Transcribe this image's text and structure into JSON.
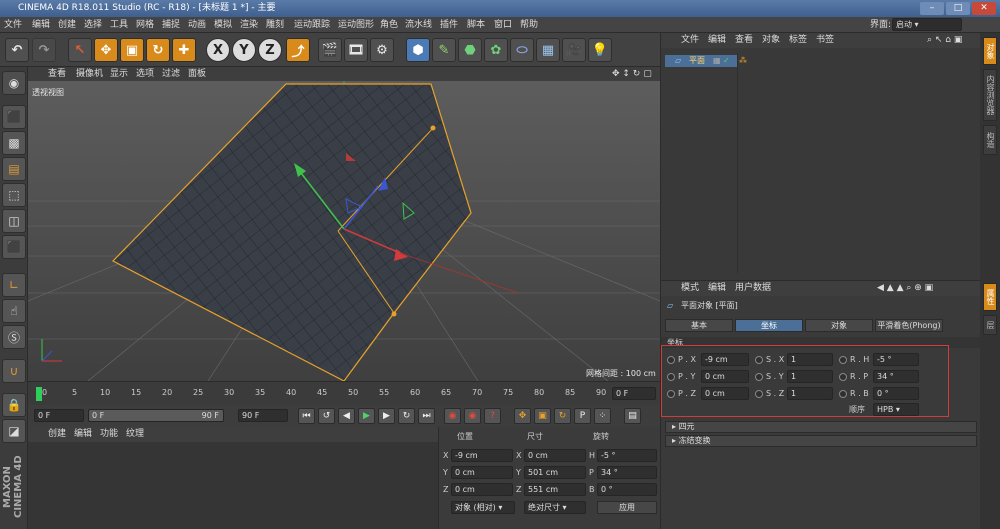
{
  "title": {
    "text": "CINEMA 4D R18.011 Studio (RC - R18) - [未标题 1 *] - 主要"
  },
  "layout_label": "界面:",
  "layout_value": "启动",
  "menu": [
    "文件",
    "编辑",
    "创建",
    "选择",
    "工具",
    "网格",
    "捕捉",
    "动画",
    "模拟",
    "渲染",
    "雕刻",
    "运动跟踪",
    "运动图形",
    "角色",
    "流水线",
    "插件",
    "脚本",
    "窗口",
    "帮助"
  ],
  "toolbar": {
    "axis_x": "X",
    "axis_y": "Y",
    "axis_z": "Z"
  },
  "viewport": {
    "menu": [
      "查看",
      "摄像机",
      "显示",
      "选项",
      "过滤",
      "面板"
    ],
    "label": "透视视图",
    "grid_info": "网格间距 : 100 cm"
  },
  "timeline": {
    "ticks": [
      "0",
      "5",
      "10",
      "15",
      "20",
      "25",
      "30",
      "35",
      "40",
      "45",
      "50",
      "55",
      "60",
      "65",
      "70",
      "75",
      "80",
      "85",
      "90"
    ],
    "end_field": "0 F"
  },
  "playbar": {
    "start": "0 F",
    "range_start": "0 F",
    "range_end": "90 F",
    "end": "90 F"
  },
  "material_manager": {
    "menu": [
      "创建",
      "编辑",
      "功能",
      "纹理"
    ]
  },
  "coord_manager": {
    "headers": {
      "position": "位置",
      "size": "尺寸",
      "rotation": "旋转"
    },
    "rows": [
      {
        "axis": "X",
        "pos": "-9 cm",
        "saxis": "X",
        "size": "0 cm",
        "raxis": "H",
        "rot": "-5 °"
      },
      {
        "axis": "Y",
        "pos": "0 cm",
        "saxis": "Y",
        "size": "501 cm",
        "raxis": "P",
        "rot": "34 °"
      },
      {
        "axis": "Z",
        "pos": "0 cm",
        "saxis": "Z",
        "size": "551 cm",
        "raxis": "B",
        "rot": "0 °"
      }
    ],
    "mode": "对象 (相对)",
    "size_mode": "绝对尺寸",
    "apply": "应用"
  },
  "object_manager": {
    "menu": [
      "文件",
      "编辑",
      "查看",
      "对象",
      "标签",
      "书签"
    ],
    "object_name": "平面"
  },
  "attribute_manager": {
    "menu": [
      "模式",
      "编辑",
      "用户数据"
    ],
    "object_title": "平面对象 [平面]",
    "tabs": [
      "基本",
      "坐标",
      "对象",
      "平滑着色(Phong)"
    ],
    "section": "坐标",
    "rows": [
      {
        "p_label": "P . X",
        "p_val": "-9 cm",
        "s_label": "S . X",
        "s_val": "1",
        "r_label": "R . H",
        "r_val": "-5 °"
      },
      {
        "p_label": "P . Y",
        "p_val": "0 cm",
        "s_label": "S . Y",
        "s_val": "1",
        "r_label": "R . P",
        "r_val": "34 °"
      },
      {
        "p_label": "P . Z",
        "p_val": "0 cm",
        "s_label": "S . Z",
        "s_val": "1",
        "r_label": "R . B",
        "r_val": "0 °"
      }
    ],
    "order_label": "顺序",
    "order_value": "HPB",
    "group1": "四元",
    "group2": "冻结变换"
  },
  "right_tabs": [
    "对象",
    "内容浏览器",
    "构造",
    "属性",
    "层"
  ],
  "brand": "MAXON CINEMA 4D",
  "colors": {
    "accent": "#4b6f97",
    "selection": "#e8a22a",
    "highlight_box": "#d43a3a"
  }
}
